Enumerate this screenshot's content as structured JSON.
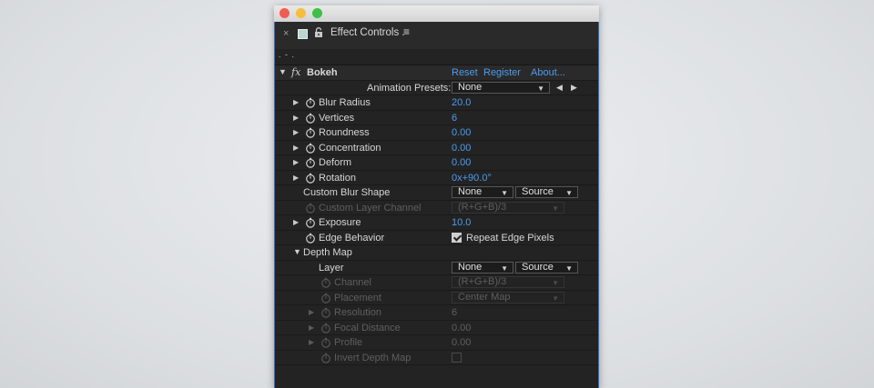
{
  "panel": {
    "title": "Effect Controls",
    "title_suffix": ".",
    "menu_glyph": "≡",
    "close_glyph": "×",
    "layer_path": ". - ."
  },
  "effect": {
    "name": "Bokeh",
    "fx_label": "fx",
    "reset_label": "Reset",
    "register_label": "Register",
    "about_label": "About..."
  },
  "presets": {
    "label": "Animation Presets:",
    "value": "None"
  },
  "properties": {
    "blur_radius": {
      "label": "Blur Radius",
      "value": "20.0"
    },
    "vertices": {
      "label": "Vertices",
      "value": "6"
    },
    "roundness": {
      "label": "Roundness",
      "value": "0.00"
    },
    "concentration": {
      "label": "Concentration",
      "value": "0.00"
    },
    "deform": {
      "label": "Deform",
      "value": "0.00"
    },
    "rotation": {
      "label": "Rotation",
      "value": "0x+90.0°"
    },
    "custom_blur_shape": {
      "label": "Custom Blur Shape",
      "layer_value": "None",
      "source_value": "Source"
    },
    "custom_layer_channel": {
      "label": "Custom Layer Channel",
      "value": "(R+G+B)/3"
    },
    "exposure": {
      "label": "Exposure",
      "value": "10.0"
    },
    "edge_behavior": {
      "label": "Edge Behavior",
      "checkbox_label": "Repeat Edge Pixels",
      "checked": true
    }
  },
  "depth_map": {
    "label": "Depth Map",
    "layer": {
      "label": "Layer",
      "layer_value": "None",
      "source_value": "Source"
    },
    "channel": {
      "label": "Channel",
      "value": "(R+G+B)/3"
    },
    "placement": {
      "label": "Placement",
      "value": "Center Map"
    },
    "resolution": {
      "label": "Resolution",
      "value": "6"
    },
    "focal_distance": {
      "label": "Focal Distance",
      "value": "0.00"
    },
    "profile": {
      "label": "Profile",
      "value": "0.00"
    },
    "invert_depth_map": {
      "label": "Invert Depth Map",
      "checked": false
    }
  },
  "colors": {
    "accent_blue": "#4a9df0",
    "panel_bg": "#232323",
    "focus_border": "#2f6fc0",
    "traffic_close": "#f25b52",
    "traffic_min": "#f6be3a",
    "traffic_max": "#3cc048"
  }
}
